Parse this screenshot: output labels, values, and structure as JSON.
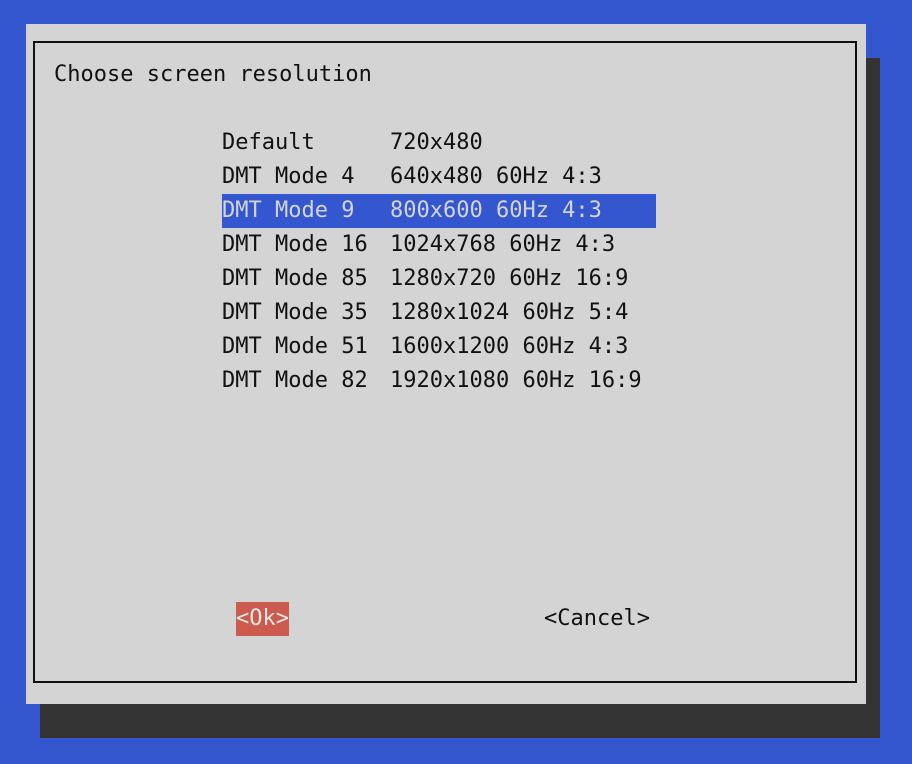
{
  "dialog": {
    "title": "Choose screen resolution",
    "items": [
      {
        "tag": "Default",
        "desc": "720x480",
        "selected": false
      },
      {
        "tag": "DMT Mode 4",
        "desc": "640x480 60Hz 4:3",
        "selected": false
      },
      {
        "tag": "DMT Mode 9",
        "desc": "800x600 60Hz 4:3",
        "selected": true
      },
      {
        "tag": "DMT Mode 16",
        "desc": "1024x768 60Hz 4:3",
        "selected": false
      },
      {
        "tag": "DMT Mode 85",
        "desc": "1280x720 60Hz 16:9",
        "selected": false
      },
      {
        "tag": "DMT Mode 35",
        "desc": "1280x1024 60Hz 5:4",
        "selected": false
      },
      {
        "tag": "DMT Mode 51",
        "desc": "1600x1200 60Hz 4:3",
        "selected": false
      },
      {
        "tag": "DMT Mode 82",
        "desc": "1920x1080 60Hz 16:9",
        "selected": false
      }
    ],
    "ok_label": "<Ok>",
    "cancel_label": "<Cancel>"
  },
  "colors": {
    "background": "#3457d0",
    "dialog": "#d4d4d4",
    "selection": "#3457d0",
    "ok_button": "#cd5a4f"
  }
}
